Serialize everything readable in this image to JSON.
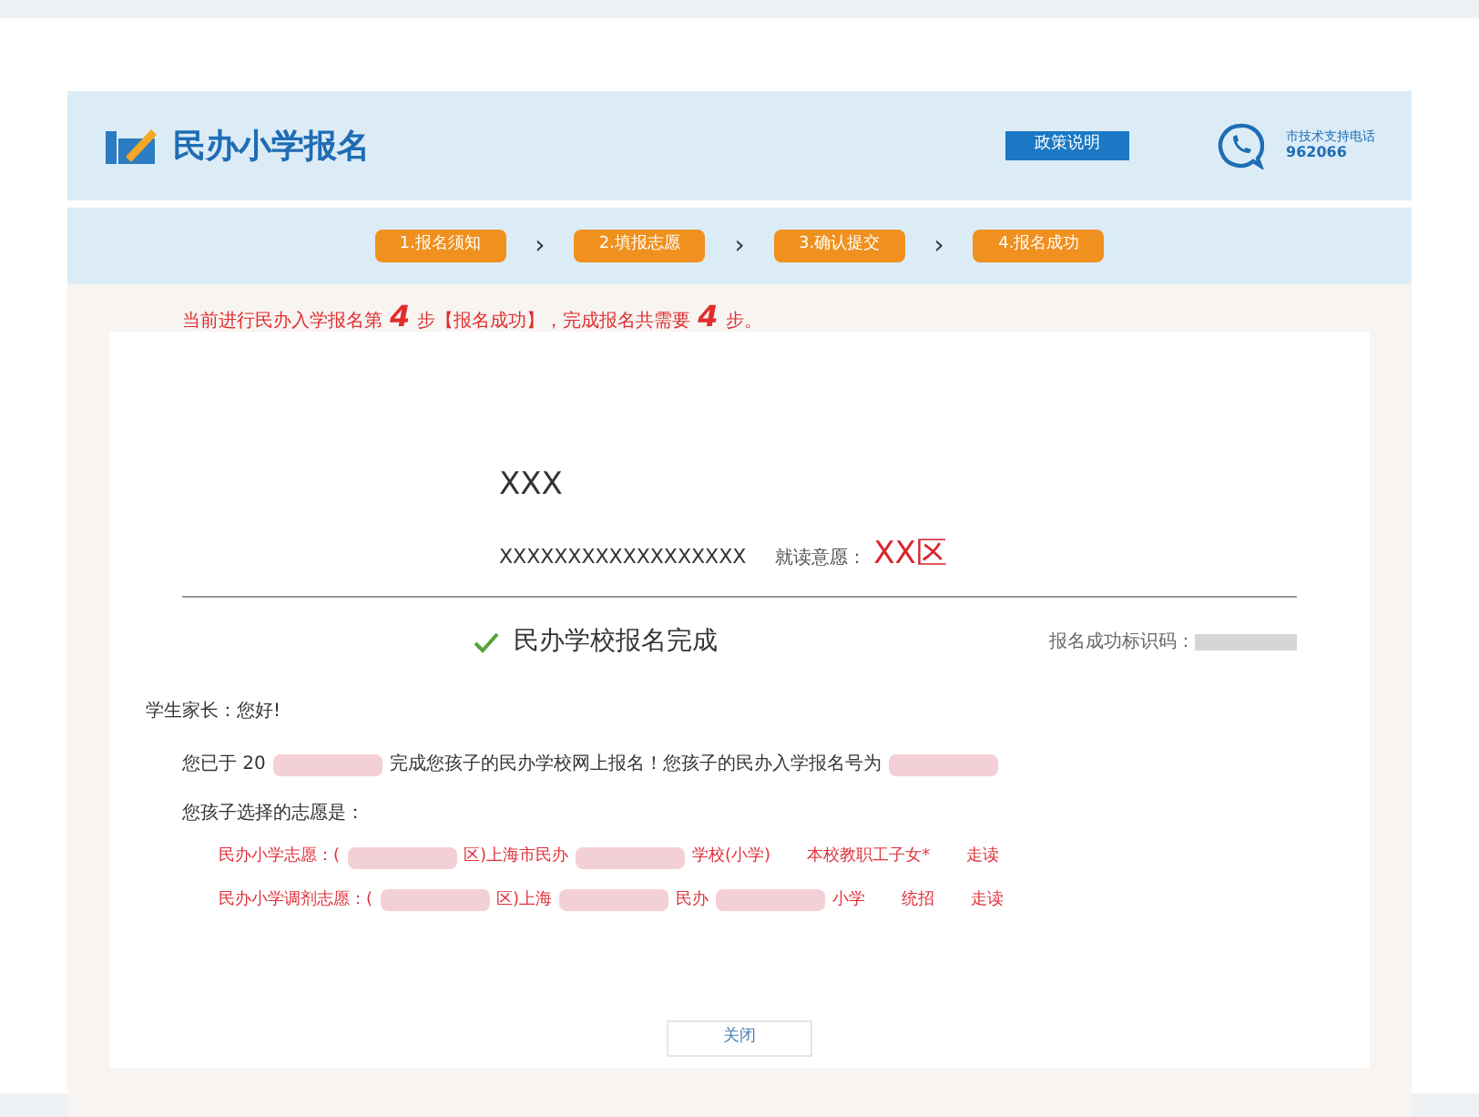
{
  "header": {
    "title": "民办小学报名",
    "policy_button": "政策说明",
    "support_label": "市技术支持电话",
    "support_phone": "962066"
  },
  "steps": [
    {
      "label": "1.报名须知",
      "separator": "›"
    },
    {
      "label": "2.填报志愿",
      "separator": "›"
    },
    {
      "label": "3.确认提交",
      "separator": "›"
    },
    {
      "label": "4.报名成功"
    }
  ],
  "notice": {
    "prefix": "当前进行民办入学报名第",
    "current": "4",
    "middle": "步【报名成功】，完成报名共需要",
    "total": "4",
    "suffix": "步。"
  },
  "student": {
    "name": "XXX",
    "id_number": "XXXXXXXXXXXXXXXXXX",
    "district_label": "就读意愿：",
    "district": "XX区"
  },
  "result": {
    "title": "民办学校报名完成",
    "code_label": "报名成功标识码："
  },
  "letter": {
    "greeting": "学生家长：您好!",
    "line_1": [
      {
        "kind": "text",
        "text": "您已于 20"
      },
      {
        "kind": "redacted"
      },
      {
        "kind": "text",
        "text": "完成您孩子的民办学校网上报名！您孩子的民办入学报名号为"
      },
      {
        "kind": "redacted"
      }
    ],
    "choices_intro": "您孩子选择的志愿是：",
    "choices": [
      {
        "parts": [
          {
            "kind": "text",
            "text": "民办小学志愿：("
          },
          {
            "kind": "redacted"
          },
          {
            "kind": "text",
            "text": "区)上海市民办"
          },
          {
            "kind": "redacted"
          },
          {
            "kind": "text",
            "text": "学校(小学)"
          }
        ],
        "category": "本校教职工子女*",
        "mode": "走读"
      },
      {
        "parts": [
          {
            "kind": "text",
            "text": "民办小学调剂志愿：("
          },
          {
            "kind": "redacted"
          },
          {
            "kind": "text",
            "text": "区)上海"
          },
          {
            "kind": "redacted"
          },
          {
            "kind": "text",
            "text": "民办"
          },
          {
            "kind": "redacted"
          },
          {
            "kind": "text",
            "text": "小学"
          }
        ],
        "category": "统招",
        "mode": "走读"
      }
    ]
  },
  "close_button": "关闭"
}
